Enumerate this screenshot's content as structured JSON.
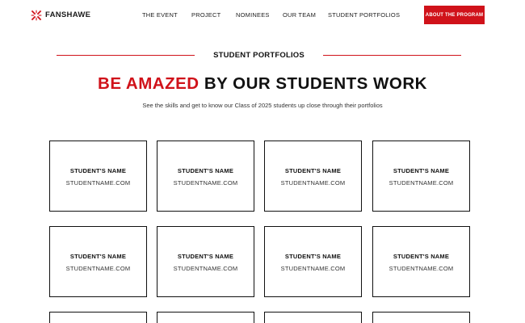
{
  "brand": {
    "name": "FANSHAWE",
    "logo_icon": "fanshawe-star-icon",
    "accent_color": "#d0121a"
  },
  "nav": {
    "items": [
      {
        "label": "THE EVENT"
      },
      {
        "label": "PROJECT"
      },
      {
        "label": "NOMINEES"
      },
      {
        "label": "OUR TEAM"
      },
      {
        "label": "STUDENT PORTFOLIOS"
      }
    ],
    "cta_label": "ABOUT THE PROGRAM"
  },
  "section": {
    "label": "STUDENT PORTFOLIOS",
    "headline_accent": "BE AMAZED",
    "headline_rest": "BY OUR STUDENTS WORK",
    "subline": "See the skills and get to know our Class of 2025 students up close through their portfolios"
  },
  "portfolios": [
    {
      "name": "STUDENT'S NAME",
      "site": "STUDENTNAME.COM"
    },
    {
      "name": "STUDENT'S NAME",
      "site": "STUDENTNAME.COM"
    },
    {
      "name": "STUDENT'S NAME",
      "site": "STUDENTNAME.COM"
    },
    {
      "name": "STUDENT'S NAME",
      "site": "STUDENTNAME.COM"
    },
    {
      "name": "STUDENT'S NAME",
      "site": "STUDENTNAME.COM"
    },
    {
      "name": "STUDENT'S NAME",
      "site": "STUDENTNAME.COM"
    },
    {
      "name": "STUDENT'S NAME",
      "site": "STUDENTNAME.COM"
    },
    {
      "name": "STUDENT'S NAME",
      "site": "STUDENTNAME.COM"
    },
    {
      "name": "",
      "site": ""
    },
    {
      "name": "",
      "site": ""
    },
    {
      "name": "",
      "site": ""
    },
    {
      "name": "",
      "site": ""
    }
  ]
}
